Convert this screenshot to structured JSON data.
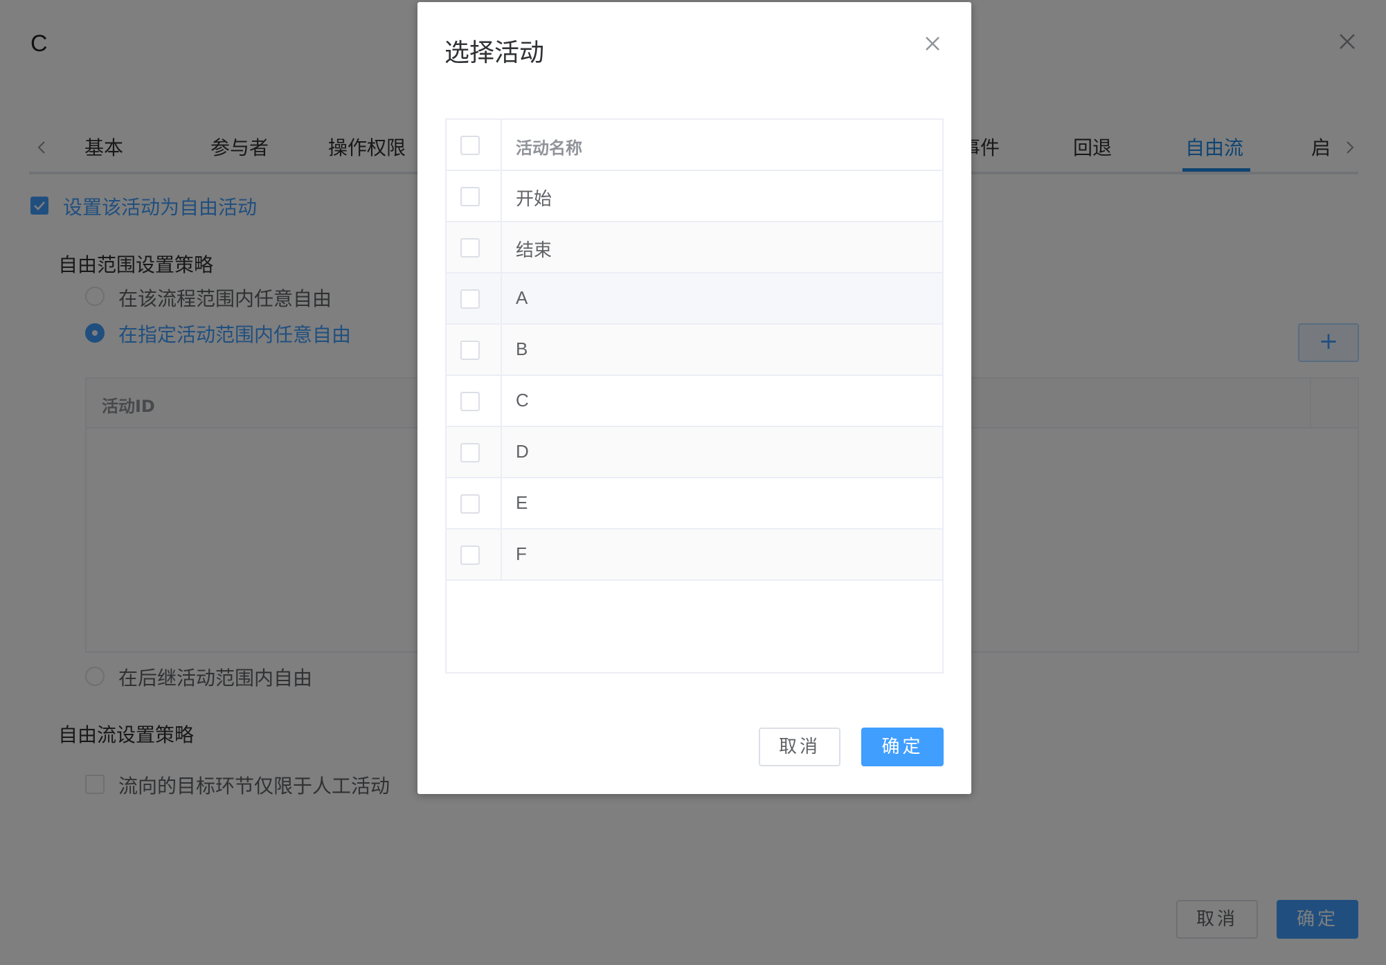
{
  "panel": {
    "title": "C",
    "tabs": [
      "基本",
      "参与者",
      "操作权限",
      "事件",
      "回退",
      "自由流",
      "启"
    ],
    "active_tab": "自由流",
    "free_activity_checkbox_label": "设置该活动为自由活动",
    "scope_section_title": "自由范围设置策略",
    "scope_options": [
      "在该流程范围内任意自由",
      "在指定活动范围内任意自由",
      "在后继活动范围内自由"
    ],
    "selected_scope": "在指定活动范围内任意自由",
    "add_button_label": "+",
    "table_header": "活动ID",
    "flow_section_title": "自由流设置策略",
    "flow_option_label": "流向的目标环节仅限于人工活动",
    "cancel_label": "取消",
    "confirm_label": "确定"
  },
  "dialog": {
    "title": "选择活动",
    "column_header": "活动名称",
    "rows": [
      "开始",
      "结束",
      "A",
      "B",
      "C",
      "D",
      "E",
      "F"
    ],
    "cancel_label": "取消",
    "confirm_label": "确定"
  },
  "colors": {
    "accent": "#409eff",
    "tab_active": "#1e88e5"
  }
}
